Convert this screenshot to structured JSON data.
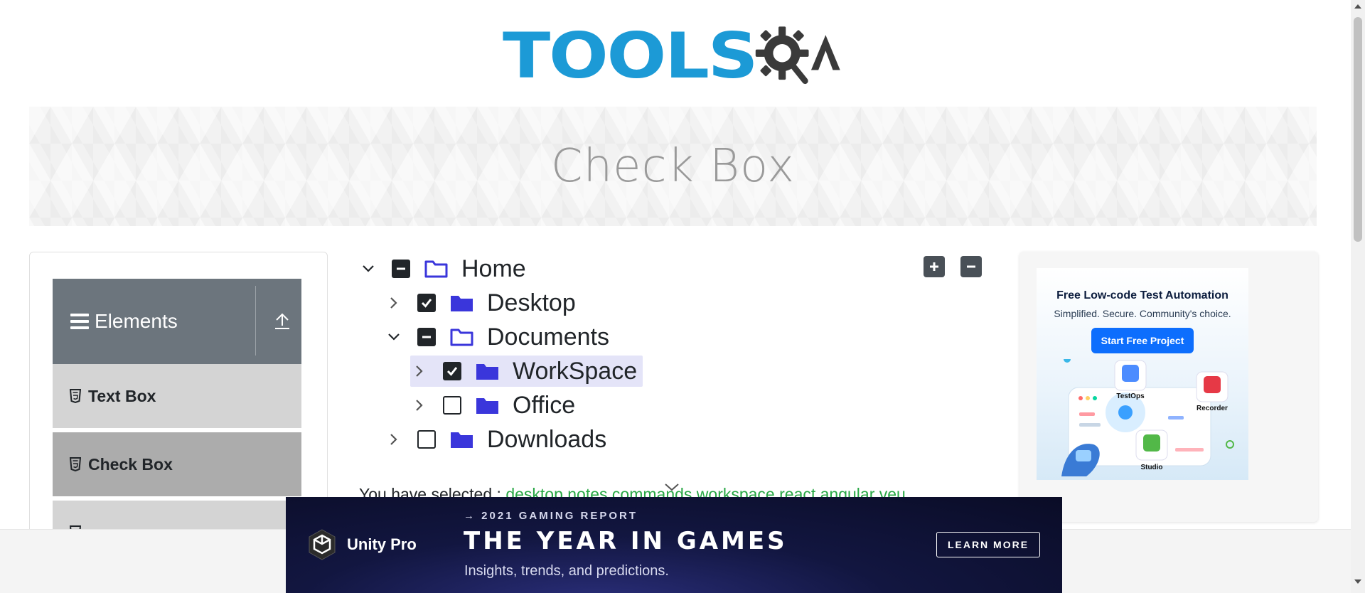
{
  "header": {
    "logo_text": "TOOLS",
    "logo_suffix": "A"
  },
  "banner": {
    "title": "Check Box"
  },
  "sidebar": {
    "group_title": "Elements",
    "items": [
      {
        "label": "Text Box"
      },
      {
        "label": "Check Box"
      }
    ]
  },
  "tree": {
    "nodes": [
      {
        "label": "Home",
        "state": "half",
        "expanded": true,
        "level": 0
      },
      {
        "label": "Desktop",
        "state": "checked",
        "expanded": false,
        "level": 1
      },
      {
        "label": "Documents",
        "state": "half",
        "expanded": true,
        "level": 1
      },
      {
        "label": "WorkSpace",
        "state": "checked",
        "expanded": false,
        "level": 2,
        "highlighted": true
      },
      {
        "label": "Office",
        "state": "unchecked",
        "expanded": false,
        "level": 2
      },
      {
        "label": "Downloads",
        "state": "unchecked",
        "expanded": false,
        "level": 1
      }
    ]
  },
  "result": {
    "label": "You have selected :",
    "selected": "desktop notes commands workspace react angular veu"
  },
  "right_ad": {
    "headline": "Free Low-code Test Automation",
    "subline": "Simplified. Secure. Community's choice.",
    "button": "Start Free Project",
    "badges": [
      "TestOps",
      "Recorder",
      "Studio"
    ]
  },
  "bottom_ad": {
    "brand": "Unity Pro",
    "kicker": "→ 2021 GAMING REPORT",
    "headline": "THE YEAR IN GAMES",
    "subline": "Insights, trends, and predictions.",
    "cta": "LEARN MORE"
  },
  "colors": {
    "brand_blue": "#1c9ad6",
    "sidebar_header": "#6c757d",
    "menu_item": "#d4d4d4",
    "menu_item_active": "#acacac",
    "folder_blue": "#3a36db",
    "selected_text": "#28a745"
  }
}
